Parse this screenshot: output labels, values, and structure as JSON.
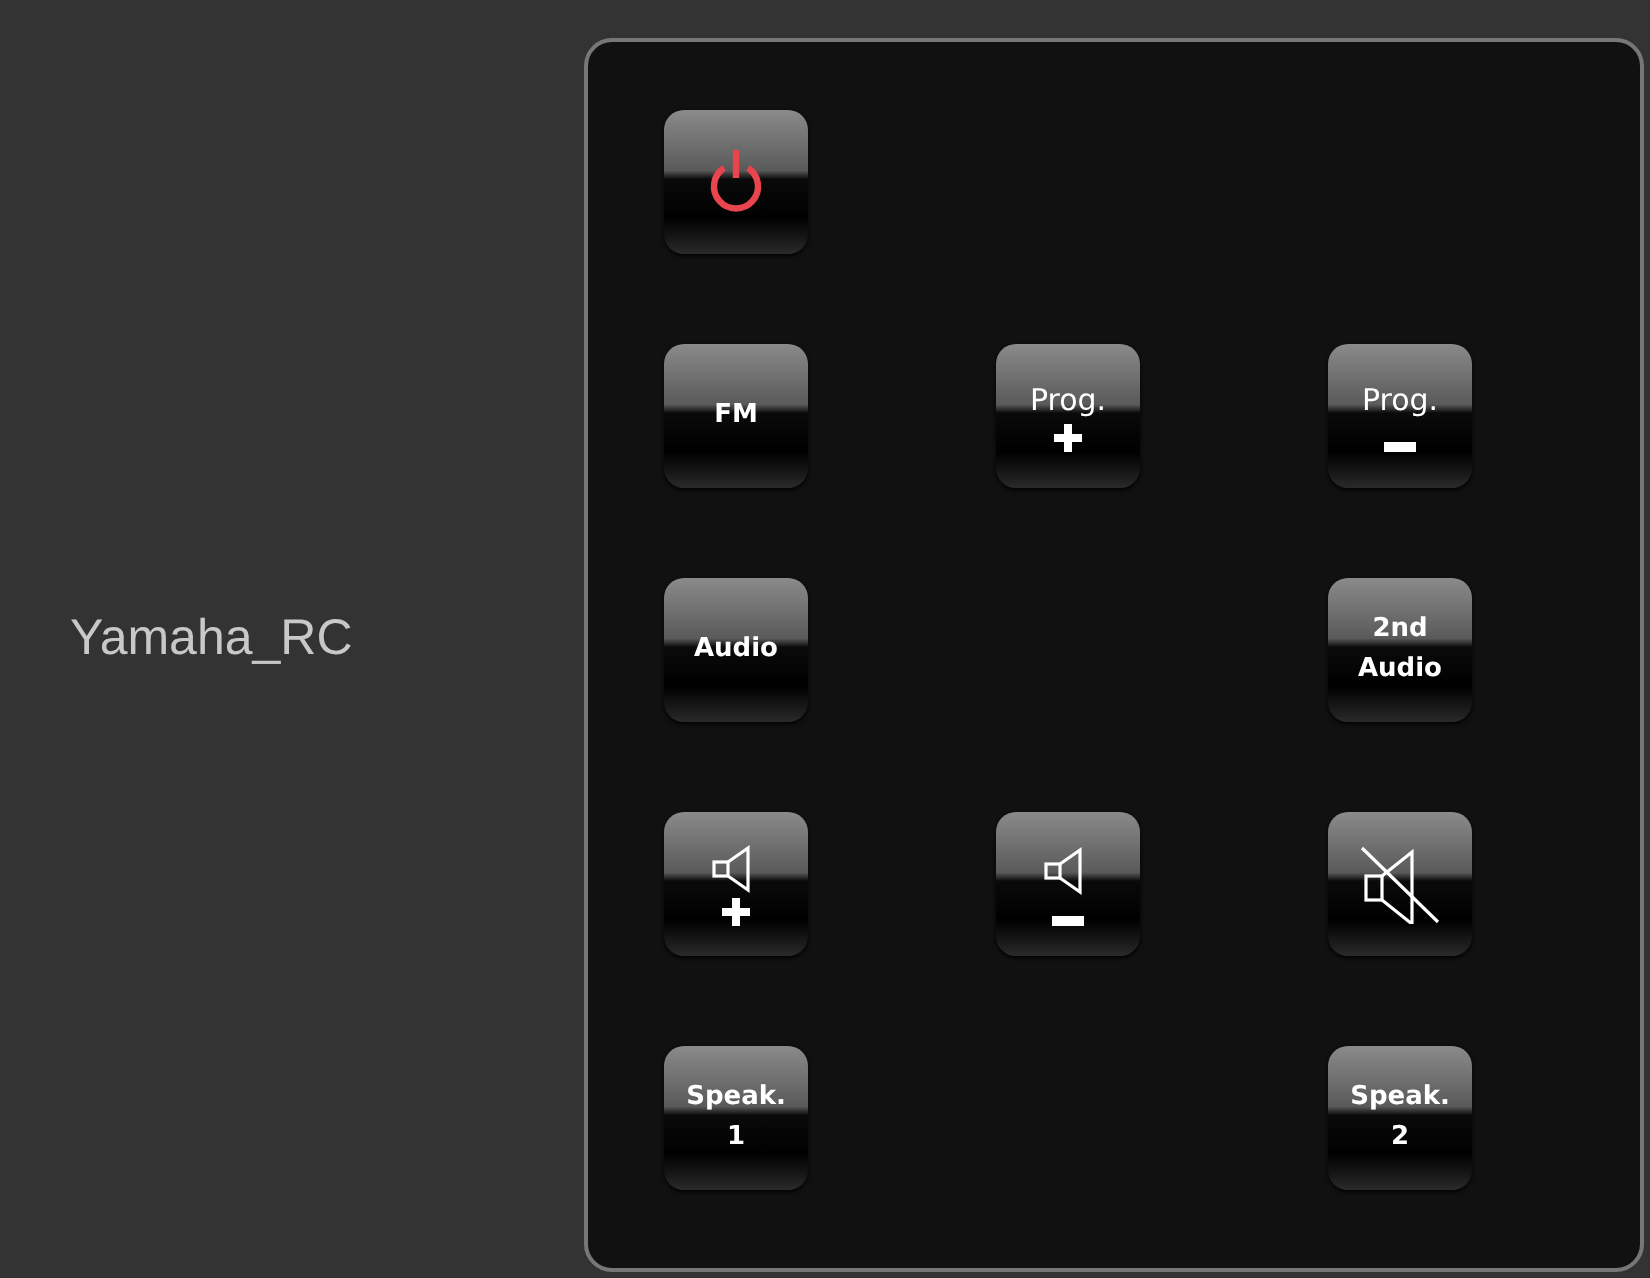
{
  "device": {
    "name": "Yamaha_RC"
  },
  "rows": [
    {
      "buttons": [
        {
          "kind": "power"
        },
        {
          "kind": "empty"
        },
        {
          "kind": "empty"
        }
      ]
    },
    {
      "buttons": [
        {
          "kind": "text",
          "lines": [
            "FM"
          ]
        },
        {
          "kind": "text_plus",
          "lines": [
            "Prog."
          ]
        },
        {
          "kind": "text_minus",
          "lines": [
            "Prog."
          ]
        }
      ]
    },
    {
      "buttons": [
        {
          "kind": "text",
          "lines": [
            "Audio"
          ]
        },
        {
          "kind": "empty"
        },
        {
          "kind": "text",
          "lines": [
            "2nd",
            "Audio"
          ]
        }
      ]
    },
    {
      "buttons": [
        {
          "kind": "volume_up"
        },
        {
          "kind": "volume_down"
        },
        {
          "kind": "mute"
        }
      ]
    },
    {
      "buttons": [
        {
          "kind": "text",
          "lines": [
            "Speak.",
            "1"
          ]
        },
        {
          "kind": "empty"
        },
        {
          "kind": "text",
          "lines": [
            "Speak.",
            "2"
          ]
        }
      ]
    }
  ]
}
